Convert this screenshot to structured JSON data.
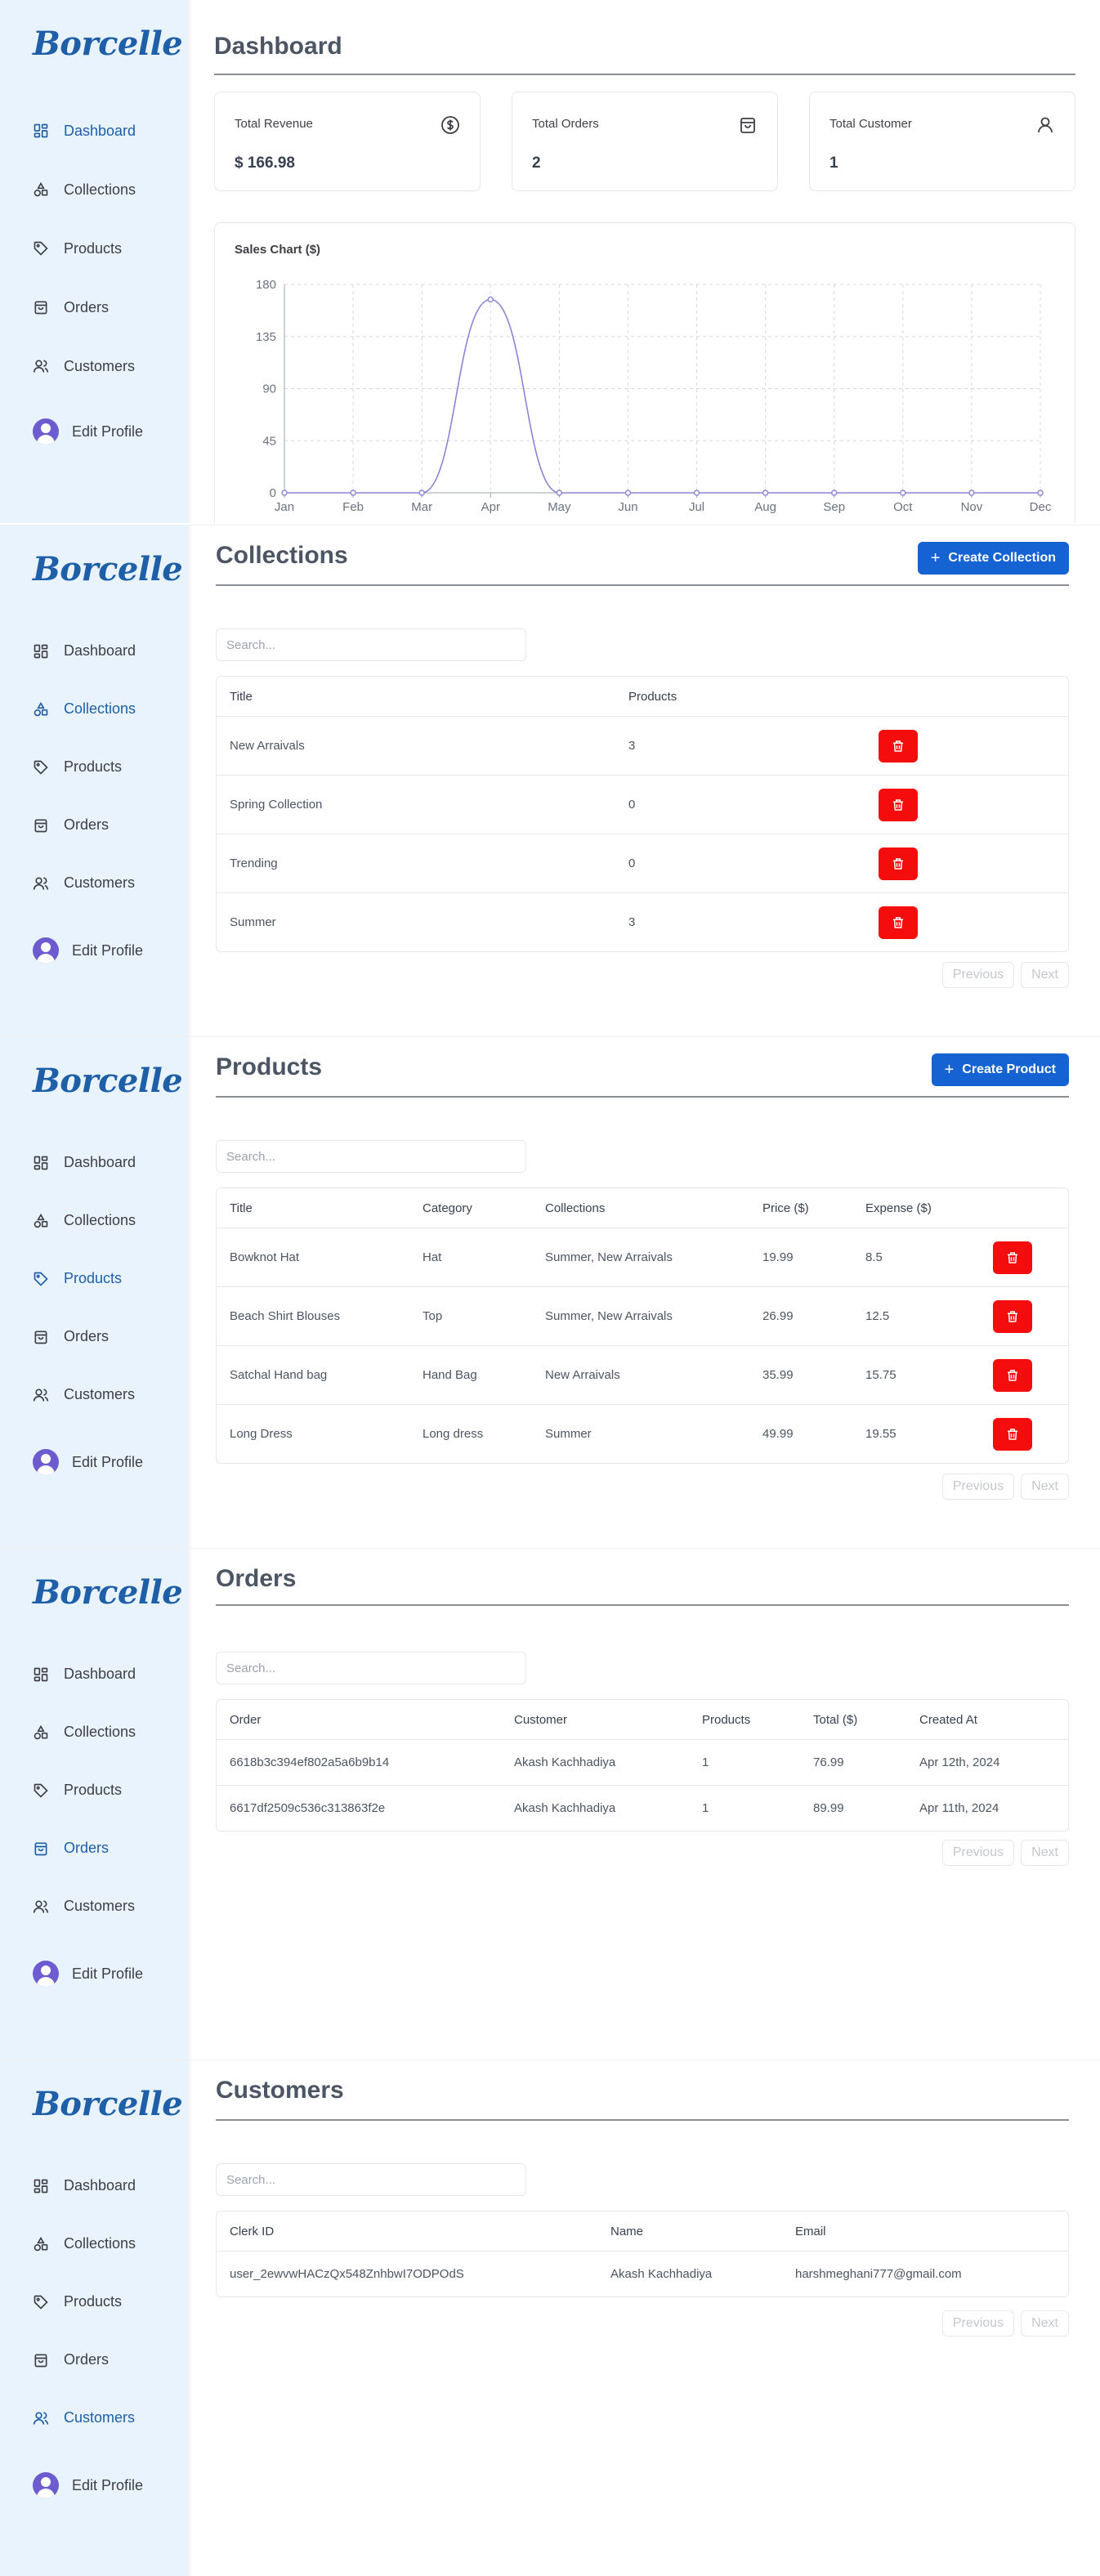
{
  "brand": "Borcelle",
  "nav": {
    "dashboard": "Dashboard",
    "collections": "Collections",
    "products": "Products",
    "orders": "Orders",
    "customers": "Customers",
    "edit_profile": "Edit Profile"
  },
  "colors": {
    "accent": "#1563d3",
    "sidebar_bg": "#e8f3fd",
    "danger": "#f50c0c",
    "active_nav": "#1e5fa8",
    "chart_line": "#8b84d7"
  },
  "dashboard": {
    "title": "Dashboard",
    "cards": [
      {
        "label": "Total Revenue",
        "value": "$ 166.98",
        "icon": "dollar-circle-icon"
      },
      {
        "label": "Total Orders",
        "value": "2",
        "icon": "shopping-bag-icon"
      },
      {
        "label": "Total Customer",
        "value": "1",
        "icon": "user-icon"
      }
    ],
    "chart_title": "Sales Chart ($)"
  },
  "chart_data": {
    "type": "area",
    "title": "Sales Chart ($)",
    "categories": [
      "Jan",
      "Feb",
      "Mar",
      "Apr",
      "May",
      "Jun",
      "Jul",
      "Aug",
      "Sep",
      "Oct",
      "Nov",
      "Dec"
    ],
    "values": [
      0,
      0,
      0,
      166.98,
      0,
      0,
      0,
      0,
      0,
      0,
      0,
      0
    ],
    "yticks": [
      0,
      45,
      90,
      135,
      180
    ],
    "ylim": [
      0,
      180
    ],
    "grid": true
  },
  "collections": {
    "title": "Collections",
    "create_label": "Create Collection",
    "search_placeholder": "Search...",
    "headers": [
      "Title",
      "Products"
    ],
    "rows": [
      {
        "title": "New Arraivals",
        "products": "3"
      },
      {
        "title": "Spring Collection",
        "products": "0"
      },
      {
        "title": "Trending",
        "products": "0"
      },
      {
        "title": "Summer",
        "products": "3"
      }
    ]
  },
  "products": {
    "title": "Products",
    "create_label": "Create Product",
    "search_placeholder": "Search...",
    "headers": [
      "Title",
      "Category",
      "Collections",
      "Price ($)",
      "Expense ($)"
    ],
    "rows": [
      {
        "title": "Bowknot Hat",
        "category": "Hat",
        "collections": "Summer, New Arraivals",
        "price": "19.99",
        "expense": "8.5"
      },
      {
        "title": "Beach Shirt Blouses",
        "category": "Top",
        "collections": "Summer, New Arraivals",
        "price": "26.99",
        "expense": "12.5"
      },
      {
        "title": "Satchal Hand bag",
        "category": "Hand Bag",
        "collections": "New Arraivals",
        "price": "35.99",
        "expense": "15.75"
      },
      {
        "title": "Long Dress",
        "category": "Long dress",
        "collections": "Summer",
        "price": "49.99",
        "expense": "19.55"
      }
    ]
  },
  "orders": {
    "title": "Orders",
    "search_placeholder": "Search...",
    "headers": [
      "Order",
      "Customer",
      "Products",
      "Total ($)",
      "Created At"
    ],
    "rows": [
      {
        "order": "6618b3c394ef802a5a6b9b14",
        "customer": "Akash Kachhadiya",
        "products": "1",
        "total": "76.99",
        "created": "Apr 12th, 2024"
      },
      {
        "order": "6617df2509c536c313863f2e",
        "customer": "Akash Kachhadiya",
        "products": "1",
        "total": "89.99",
        "created": "Apr 11th, 2024"
      }
    ]
  },
  "customers": {
    "title": "Customers",
    "search_placeholder": "Search...",
    "headers": [
      "Clerk ID",
      "Name",
      "Email"
    ],
    "rows": [
      {
        "clerk_id": "user_2ewvwHACzQx548ZnhbwI7ODPOdS",
        "name": "Akash Kachhadiya",
        "email": "harshmeghani777@gmail.com"
      }
    ]
  },
  "pager": {
    "previous": "Previous",
    "next": "Next"
  }
}
